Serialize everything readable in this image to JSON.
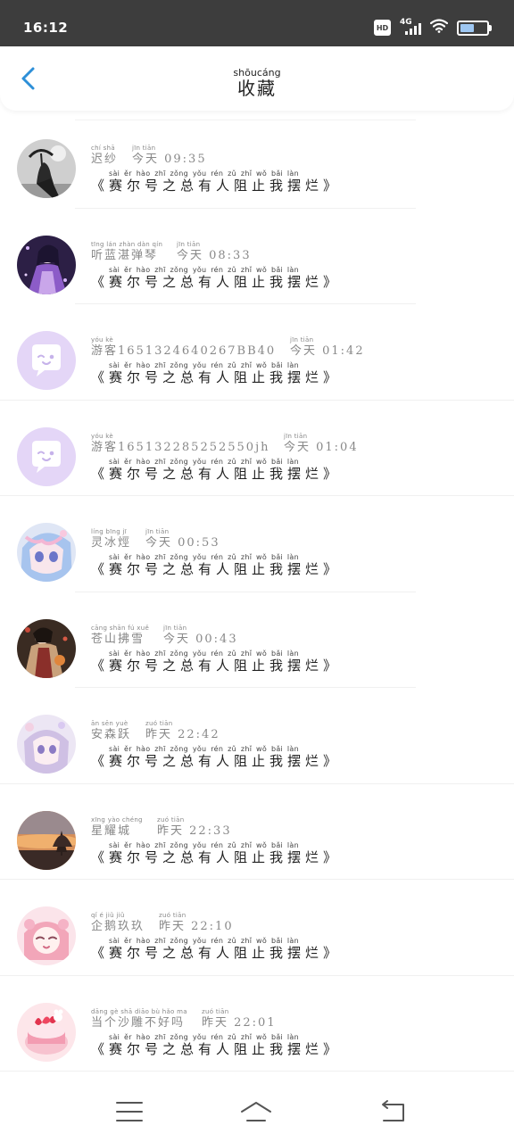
{
  "status_bar": {
    "time": "16:12",
    "network": "4G",
    "icons": [
      "hd-icon",
      "signal-4g-icon",
      "wifi-icon",
      "battery-icon"
    ],
    "battery_level": 0.55
  },
  "header": {
    "title": "收藏",
    "title_pinyin": "shōucáng",
    "back_icon": "chevron-left-icon",
    "accent_color": "#2d8fd8"
  },
  "items": [
    {
      "name": "迟纱",
      "name_pinyin": "chí shā",
      "date": "今天 09:35",
      "date_pinyin": "jīn tiān",
      "content": "《赛尔号之总有人阻止我摆烂》",
      "content_pinyin": "sài ěr hào zhī zǒng yǒu rén zǔ zhǐ wǒ bǎi làn",
      "avatar": "dark-figure-umbrella"
    },
    {
      "name": "听蓝湛弹琴",
      "name_pinyin": "tīng lán zhàn dàn qín",
      "date": "今天 08:33",
      "date_pinyin": "jīn tiān",
      "content": "《赛尔号之总有人阻止我摆烂》",
      "content_pinyin": "sài ěr hào zhī zǒng yǒu rén zǔ zhǐ wǒ bǎi làn",
      "avatar": "purple-anime-character"
    },
    {
      "name": "游客1651324640267BB40",
      "name_pinyin": "yóu kè",
      "date": "今天 01:42",
      "date_pinyin": "jīn tiān",
      "content": "《赛尔号之总有人阻止我摆烂》",
      "content_pinyin": "sài ěr hào zhī zǒng yǒu rén zǔ zhǐ wǒ bǎi làn",
      "avatar": "default-chat-bubble"
    },
    {
      "name": "游客165132285252550jh",
      "name_pinyin": "yóu kè",
      "date": "今天 01:04",
      "date_pinyin": "jīn tiān",
      "content": "《赛尔号之总有人阻止我摆烂》",
      "content_pinyin": "sài ěr hào zhī zǒng yǒu rén zǔ zhǐ wǒ bǎi làn",
      "avatar": "default-chat-bubble"
    },
    {
      "name": "灵冰烴",
      "name_pinyin": "líng bīng jī",
      "date": "今天 00:53",
      "date_pinyin": "jīn tiān",
      "content": "《赛尔号之总有人阻止我摆烂》",
      "content_pinyin": "sài ěr hào zhī zǒng yǒu rén zǔ zhǐ wǒ bǎi làn",
      "avatar": "pastel-anime-face"
    },
    {
      "name": "苍山拂雪",
      "name_pinyin": "cāng shān fú xuě",
      "date": "今天 00:43",
      "date_pinyin": "jīn tiān",
      "content": "《赛尔号之总有人阻止我摆烂》",
      "content_pinyin": "sài ěr hào zhī zǒng yǒu rén zǔ zhǐ wǒ bǎi làn",
      "avatar": "ancient-costume-character"
    },
    {
      "name": "安森跃",
      "name_pinyin": "ān sēn yuè",
      "date": "昨天 22:42",
      "date_pinyin": "zuó tiān",
      "content": "《赛尔号之总有人阻止我摆烂》",
      "content_pinyin": "sài ěr hào zhī zǒng yǒu rén zǔ zhǐ wǒ bǎi làn",
      "avatar": "lilac-anime-girl"
    },
    {
      "name": "星耀城",
      "name_pinyin": "xīng yào chéng",
      "date": "昨天 22:33",
      "date_pinyin": "zuó tiān",
      "content": "《赛尔号之总有人阻止我摆烂》",
      "content_pinyin": "sài ěr hào zhī zǒng yǒu rén zǔ zhǐ wǒ bǎi làn",
      "avatar": "sunset-tree"
    },
    {
      "name": "企鹅玖玖",
      "name_pinyin": "qǐ é jiǔ jiǔ",
      "date": "昨天 22:10",
      "date_pinyin": "zuó tiān",
      "content": "《赛尔号之总有人阻止我摆烂》",
      "content_pinyin": "sài ěr hào zhī zǒng yǒu rén zǔ zhǐ wǒ bǎi làn",
      "avatar": "pink-cute-girl"
    },
    {
      "name": "当个沙雕不好吗",
      "name_pinyin": "dāng gè shā diāo bù hǎo ma",
      "date": "昨天 22:01",
      "date_pinyin": "zuó tiān",
      "content": "《赛尔号之总有人阻止我摆烂》",
      "content_pinyin": "sài ěr hào zhī zǒng yǒu rén zǔ zhǐ wǒ bǎi làn",
      "avatar": "strawberry-cake"
    }
  ],
  "nav_bar": {
    "icons": [
      "menu-icon",
      "home-icon",
      "back-icon"
    ]
  }
}
